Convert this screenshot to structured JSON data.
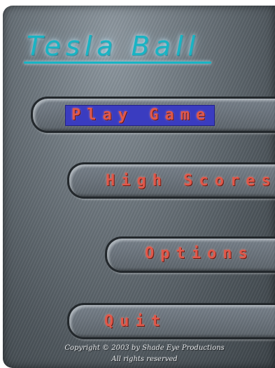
{
  "game": {
    "title": "Tesla Ball"
  },
  "menu": {
    "play_game": "Play Game",
    "high_scores": "High Scores",
    "options": "Options",
    "quit": "Quit"
  },
  "footer": {
    "copyright_line1": "Copyright © 2003 by Shade Eye Productions",
    "copyright_line2": "All rights reserved"
  },
  "colors": {
    "title": "#18b4c4",
    "menu_text": "#e0584a",
    "selected_highlight": "#3a3cc0"
  }
}
